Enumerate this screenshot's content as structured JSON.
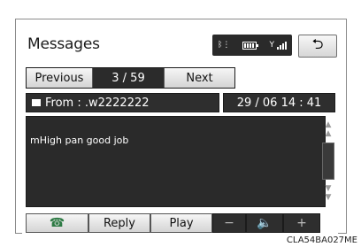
{
  "header": {
    "title": "Messages",
    "status": {
      "bluetooth_icon": "bluetooth-icon",
      "battery_icon": "battery-icon",
      "signal_icon": "signal-bars-icon"
    },
    "back_icon": "back-arrow-icon"
  },
  "navigation": {
    "previous_label": "Previous",
    "counter": "3 / 59",
    "next_label": "Next"
  },
  "message": {
    "from_label": "From : .w2222222",
    "datetime": "29 / 06  14 : 41",
    "body_text": "mHigh pan good job"
  },
  "scrollbar": {
    "up_icon": "scroll-up-icon",
    "down_icon": "scroll-down-icon"
  },
  "actions": {
    "call_icon": "phone-icon",
    "reply_label": "Reply",
    "play_label": "Play",
    "volume_down": "−",
    "volume_icon": "speaker-icon",
    "volume_up": "+"
  },
  "footer": {
    "code": "CLA54BA027ME"
  }
}
